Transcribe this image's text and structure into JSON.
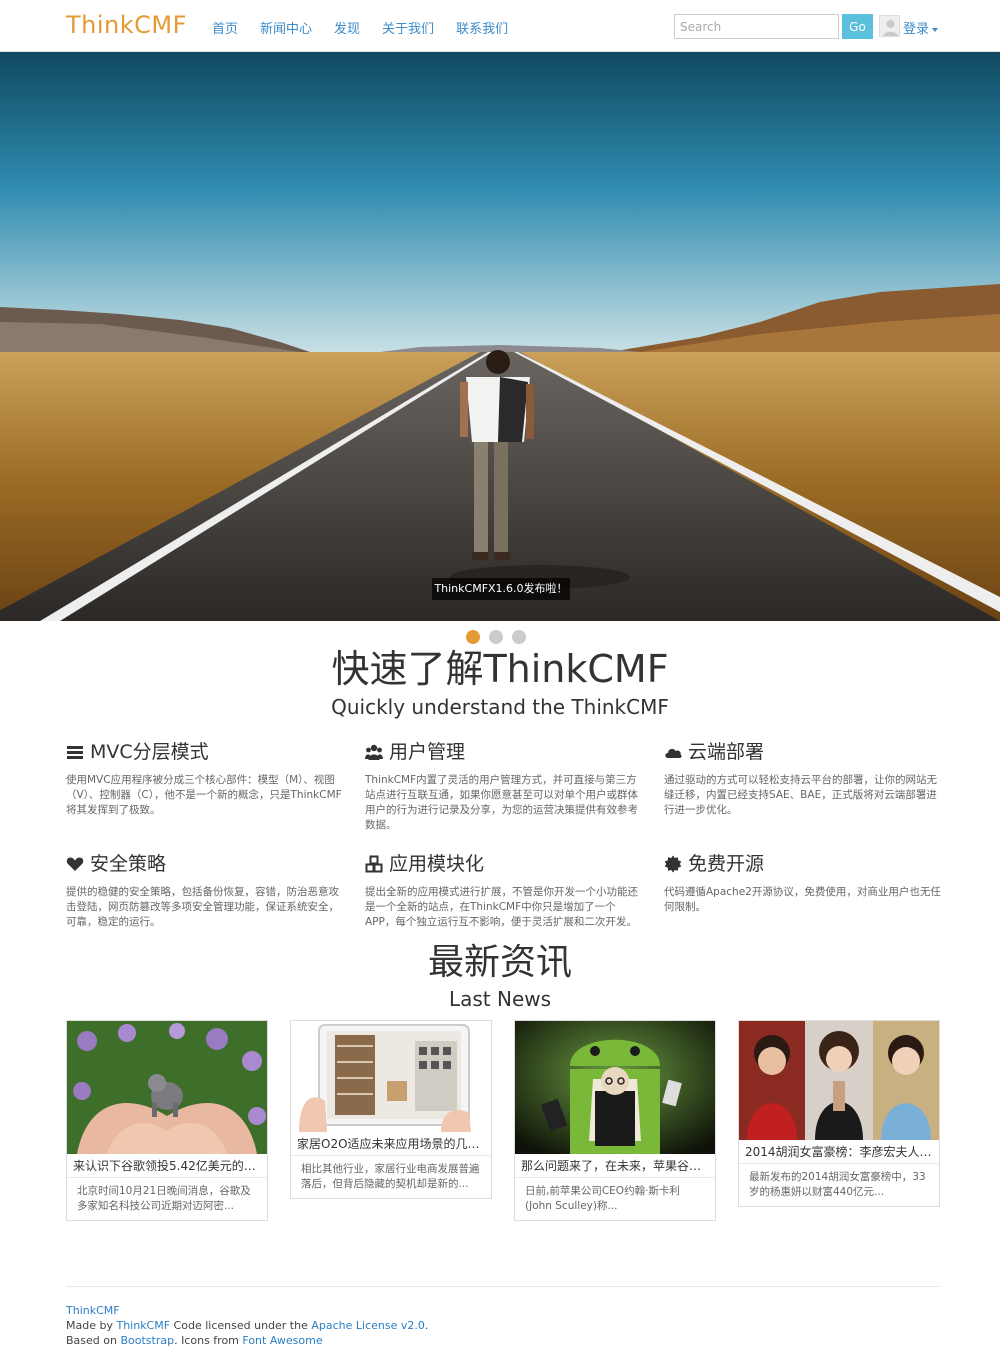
{
  "header": {
    "logo_think": "Think",
    "logo_cmf": "CMF",
    "nav": [
      "首页",
      "新闻中心",
      "发现",
      "关于我们",
      "联系我们"
    ],
    "search_placeholder": "Search",
    "go_label": "Go",
    "login_label": "登录"
  },
  "hero": {
    "caption": "ThinkCMFX1.6.0发布啦！",
    "slide_count": 3,
    "active_slide": 1
  },
  "intro": {
    "title_cn": "快速了解ThinkCMF",
    "title_en": "Quickly understand the ThinkCMF"
  },
  "features": [
    {
      "icon": "bars-icon",
      "title": "MVC分层模式",
      "text": "使用MVC应用程序被分成三个核心部件：模型（M）、视图（V）、控制器（C），他不是一个新的概念，只是ThinkCMF将其发挥到了极致。"
    },
    {
      "icon": "users-icon",
      "title": "用户管理",
      "text": "ThinkCMF内置了灵活的用户管理方式，并可直接与第三方站点进行互联互通，如果你愿意甚至可以对单个用户或群体用户的行为进行记录及分享，为您的运营决策提供有效参考数据。"
    },
    {
      "icon": "cloud-icon",
      "title": "云端部署",
      "text": "通过驱动的方式可以轻松支持云平台的部署，让你的网站无缝迁移，内置已经支持SAE、BAE，正式版将对云端部署进行进一步优化。"
    },
    {
      "icon": "heart-icon",
      "title": "安全策略",
      "text": "提供的稳健的安全策略，包括备份恢复，容错，防治恶意攻击登陆，网页防篡改等多项安全管理功能，保证系统安全，可靠，稳定的运行。"
    },
    {
      "icon": "cubes-icon",
      "title": "应用模块化",
      "text": "提出全新的应用模式进行扩展，不管是你开发一个小功能还是一个全新的站点，在ThinkCMF中你只是增加了一个APP，每个独立运行互不影响，便于灵活扩展和二次开发。"
    },
    {
      "icon": "certificate-icon",
      "title": "免费开源",
      "text": "代码遵循Apache2开源协议，免费使用，对商业用户也无任何限制。"
    }
  ],
  "news": {
    "title_cn": "最新资讯",
    "title_en": "Last News",
    "items": [
      {
        "title": "来认识下谷歌领投5.42亿美元的这...",
        "summary": "北京时间10月21日晚间消息，谷歌及多家知名科技公司近期对迈阿密..."
      },
      {
        "title": "家居O2O适应未来应用场景的几种...",
        "summary": "相比其他行业，家居行业电商发展普遍落后，但背后隐藏的契机却是新的..."
      },
      {
        "title": "那么问题来了，在未来，苹果谷歌...",
        "summary": "日前,前苹果公司CEO约翰·斯卡利(John Sculley)称..."
      },
      {
        "title": "2014胡润女富豪榜：李彦宏夫人马...",
        "summary": "最新发布的2014胡润女富豪榜中，33岁的杨惠妍以财富440亿元..."
      }
    ]
  },
  "footer": {
    "brand": "ThinkCMF",
    "made_by_prefix": "Made by ",
    "made_by_link": "ThinkCMF",
    "made_by_mid": " Code licensed under the ",
    "license_link": "Apache License v2.0",
    "made_by_suffix": ".",
    "based_prefix": "Based on ",
    "bootstrap_link": "Bootstrap",
    "based_mid": ". Icons from ",
    "fontawesome_link": "Font Awesome"
  }
}
